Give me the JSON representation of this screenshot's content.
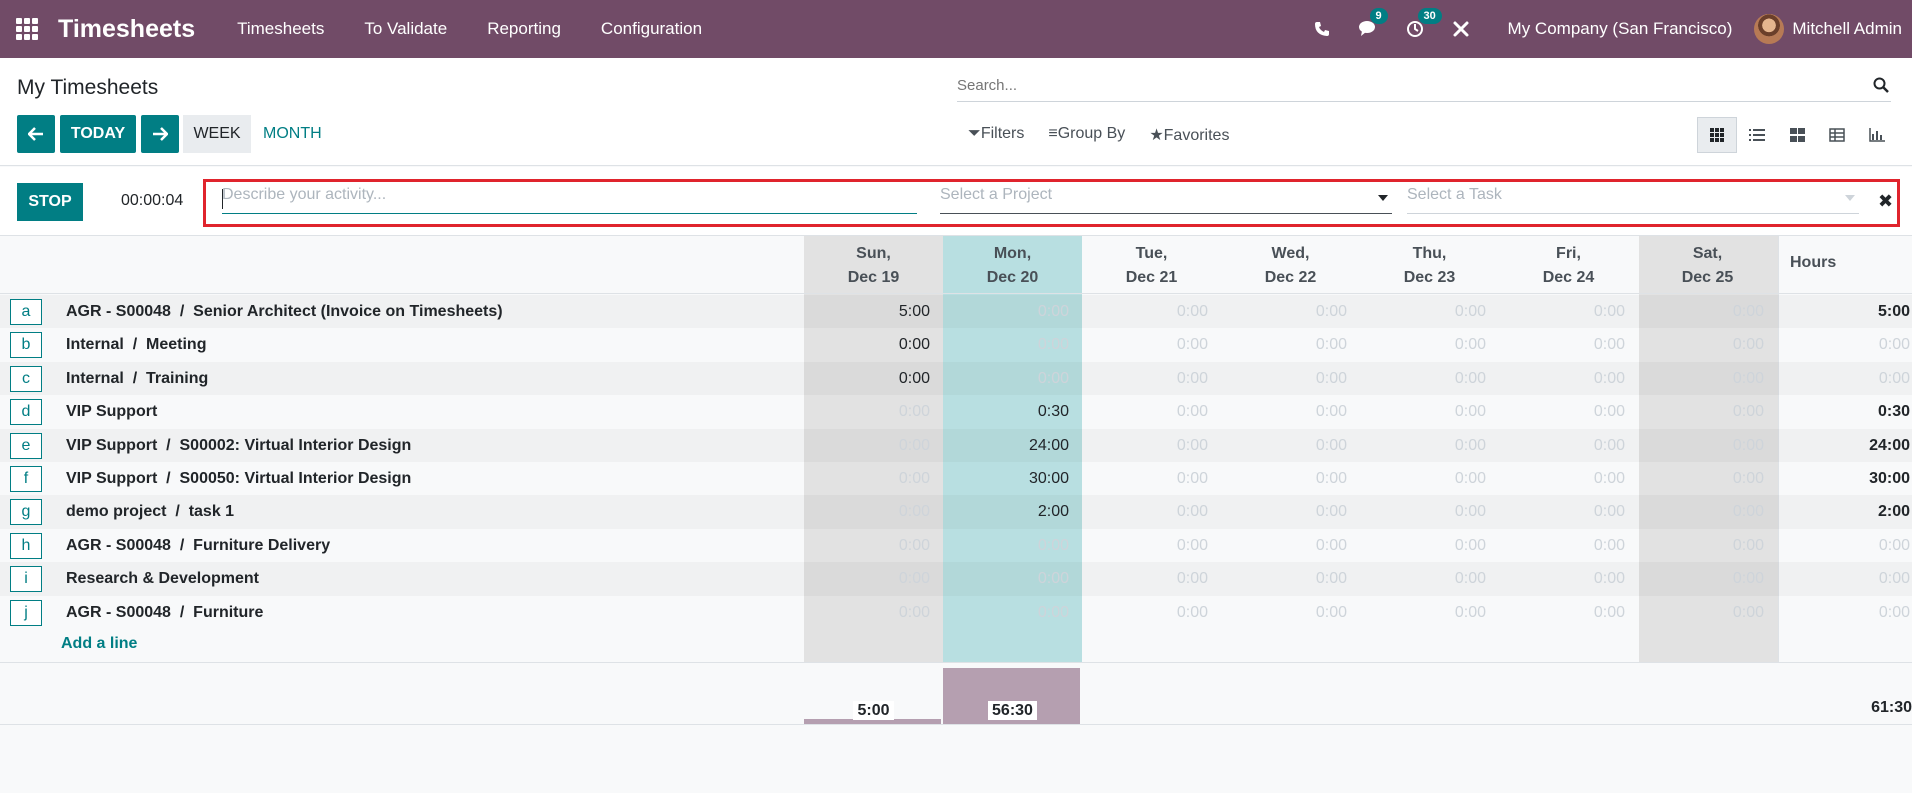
{
  "navbar": {
    "app_title": "Timesheets",
    "menu": [
      "Timesheets",
      "To Validate",
      "Reporting",
      "Configuration"
    ],
    "messages_badge": "9",
    "activities_badge": "30",
    "company": "My Company (San Francisco)",
    "user": "Mitchell Admin",
    "icons": [
      "apps-grid-icon",
      "phone-icon",
      "chat-icon",
      "clock-icon",
      "tools-icon"
    ]
  },
  "control_panel": {
    "title": "My Timesheets",
    "search_placeholder": "Search...",
    "today_label": "TODAY",
    "week_label": "WEEK",
    "month_label": "MONTH",
    "filters_label": "Filters",
    "group_by_label": "Group By",
    "favorites_label": "Favorites",
    "views": [
      "grid",
      "list",
      "kanban",
      "pivot",
      "graph"
    ]
  },
  "timer": {
    "stop_label": "STOP",
    "elapsed": "00:00:04",
    "description_placeholder": "Describe your activity...",
    "project_placeholder": "Select a Project",
    "task_placeholder": "Select a Task",
    "accent_color": "#e0242d"
  },
  "grid": {
    "days": [
      {
        "day": "Sun,",
        "date": "Dec 19",
        "weekend": true
      },
      {
        "day": "Mon,",
        "date": "Dec 20",
        "today": true
      },
      {
        "day": "Tue,",
        "date": "Dec 21"
      },
      {
        "day": "Wed,",
        "date": "Dec 22"
      },
      {
        "day": "Thu,",
        "date": "Dec 23"
      },
      {
        "day": "Fri,",
        "date": "Dec 24"
      },
      {
        "day": "Sat,",
        "date": "Dec 25",
        "weekend": true
      }
    ],
    "hours_label": "Hours",
    "rows": [
      {
        "key": "a",
        "project": "AGR - S00048",
        "task": "Senior Architect (Invoice on Timesheets)",
        "values": [
          "5:00",
          "0:00",
          "0:00",
          "0:00",
          "0:00",
          "0:00",
          "0:00"
        ],
        "total": "5:00"
      },
      {
        "key": "b",
        "project": "Internal",
        "task": "Meeting",
        "values": [
          "0:00",
          "0:00",
          "0:00",
          "0:00",
          "0:00",
          "0:00",
          "0:00"
        ],
        "total": "0:00"
      },
      {
        "key": "c",
        "project": "Internal",
        "task": "Training",
        "values": [
          "0:00",
          "0:00",
          "0:00",
          "0:00",
          "0:00",
          "0:00",
          "0:00"
        ],
        "total": "0:00"
      },
      {
        "key": "d",
        "project": "VIP Support",
        "task": "",
        "values": [
          "0:00",
          "0:30",
          "0:00",
          "0:00",
          "0:00",
          "0:00",
          "0:00"
        ],
        "total": "0:30"
      },
      {
        "key": "e",
        "project": "VIP Support",
        "task": "S00002: Virtual Interior Design",
        "values": [
          "0:00",
          "24:00",
          "0:00",
          "0:00",
          "0:00",
          "0:00",
          "0:00"
        ],
        "total": "24:00"
      },
      {
        "key": "f",
        "project": "VIP Support",
        "task": "S00050: Virtual Interior Design",
        "values": [
          "0:00",
          "30:00",
          "0:00",
          "0:00",
          "0:00",
          "0:00",
          "0:00"
        ],
        "total": "30:00"
      },
      {
        "key": "g",
        "project": "demo project",
        "task": "task 1",
        "values": [
          "0:00",
          "2:00",
          "0:00",
          "0:00",
          "0:00",
          "0:00",
          "0:00"
        ],
        "total": "2:00"
      },
      {
        "key": "h",
        "project": "AGR - S00048",
        "task": "Furniture Delivery",
        "values": [
          "0:00",
          "0:00",
          "0:00",
          "0:00",
          "0:00",
          "0:00",
          "0:00"
        ],
        "total": "0:00"
      },
      {
        "key": "i",
        "project": "Research & Development",
        "task": "",
        "values": [
          "0:00",
          "0:00",
          "0:00",
          "0:00",
          "0:00",
          "0:00",
          "0:00"
        ],
        "total": "0:00"
      },
      {
        "key": "j",
        "project": "AGR - S00048",
        "task": "Furniture",
        "values": [
          "0:00",
          "0:00",
          "0:00",
          "0:00",
          "0:00",
          "0:00",
          "0:00"
        ],
        "total": "0:00"
      }
    ],
    "non_zero": [
      [
        1,
        0,
        0,
        0,
        0,
        0,
        0
      ],
      [
        1,
        0,
        0,
        0,
        0,
        0,
        0
      ],
      [
        1,
        0,
        0,
        0,
        0,
        0,
        0
      ],
      [
        0,
        1,
        0,
        0,
        0,
        0,
        0
      ],
      [
        0,
        1,
        0,
        0,
        0,
        0,
        0
      ],
      [
        0,
        1,
        0,
        0,
        0,
        0,
        0
      ],
      [
        0,
        1,
        0,
        0,
        0,
        0,
        0
      ],
      [
        0,
        0,
        0,
        0,
        0,
        0,
        0
      ],
      [
        0,
        0,
        0,
        0,
        0,
        0,
        0
      ],
      [
        0,
        0,
        0,
        0,
        0,
        0,
        0
      ]
    ],
    "add_line_label": "Add a line",
    "day_totals": [
      "5:00",
      "56:30",
      "",
      "",
      "",
      "",
      ""
    ],
    "day_totals_hours": [
      5,
      56.5,
      0,
      0,
      0,
      0,
      0
    ],
    "grand_total": "61:30",
    "colors": {
      "today_col": "#b8dfe1",
      "weekend_col": "#e2e2e2",
      "bar": "#b59fb0",
      "primary": "#017e84",
      "navbar": "#714b67"
    }
  }
}
